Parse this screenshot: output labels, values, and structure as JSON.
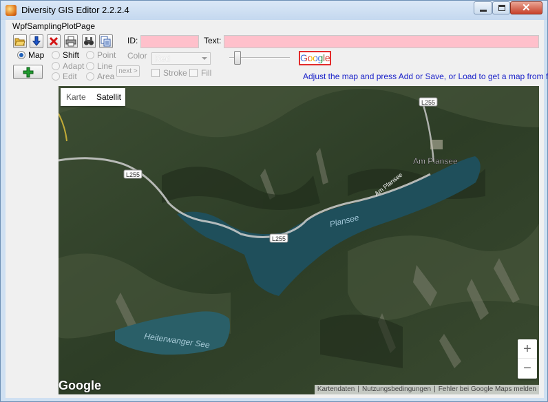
{
  "window": {
    "title": "Diversity GIS Editor 2.2.2.4"
  },
  "page": {
    "label": "WpfSamplingPlotPage"
  },
  "toolbar": {
    "buttons": [
      "open-folder-icon",
      "download-icon",
      "delete-icon",
      "print-icon",
      "binoculars-icon",
      "copy-icon"
    ]
  },
  "fields": {
    "id_label": "ID:",
    "id_value": "",
    "text_label": "Text:",
    "text_value": ""
  },
  "modes": {
    "map": "Map",
    "shift": "Shift",
    "adapt": "Adapt",
    "edit": "Edit",
    "point": "Point",
    "line": "Line",
    "area": "Area",
    "next": "next >"
  },
  "style": {
    "color_label": "Color",
    "color_value": "Red",
    "stroke_label": "Stroke",
    "fill_label": "Fill"
  },
  "google_button": "Google",
  "hint": "Adjust the map and press Add or Save, or Load to get a map from file",
  "map": {
    "tab_karte": "Karte",
    "tab_satellit": "Satellit",
    "labels": {
      "l255_a": "L255",
      "l255_b": "L255",
      "l255_c": "L255",
      "am_plansee": "Am Plansee",
      "am_plansee_road": "Am Plansee",
      "plansee": "Plansee",
      "heiterwanger": "Heiterwanger See"
    },
    "zoom_in": "+",
    "zoom_out": "−",
    "logo": "Google",
    "attribution": [
      "Kartendaten",
      "Nutzungsbedingungen",
      "Fehler bei Google Maps melden"
    ]
  },
  "colors": {
    "accent_link": "#1a22c9",
    "field_pink": "#ffc0cb",
    "lake": "#1f4f5b"
  }
}
